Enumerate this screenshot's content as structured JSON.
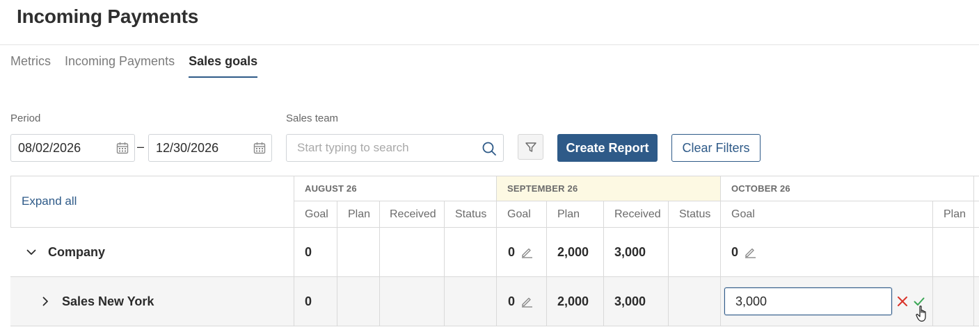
{
  "page": {
    "title": "Incoming Payments"
  },
  "tabs": [
    {
      "label": "Metrics",
      "active": false
    },
    {
      "label": "Incoming Payments",
      "active": false
    },
    {
      "label": "Sales goals",
      "active": true
    }
  ],
  "filters": {
    "period_label": "Period",
    "date_from": "08/02/2026",
    "date_separator": "–",
    "date_to": "12/30/2026",
    "sales_team_label": "Sales team",
    "sales_team_placeholder": "Start typing to search",
    "create_report_label": "Create Report",
    "clear_filters_label": "Clear Filters"
  },
  "table": {
    "expand_all_label": "Expand all",
    "months": [
      {
        "label": "AUGUST 26",
        "columns": [
          "Goal",
          "Plan",
          "Received",
          "Status"
        ]
      },
      {
        "label": "SEPTEMBER 26",
        "columns": [
          "Goal",
          "Plan",
          "Received",
          "Status"
        ],
        "highlighted": true
      },
      {
        "label": "OCTOBER 26",
        "columns": [
          "Goal",
          "Plan"
        ]
      }
    ],
    "rows": [
      {
        "name": "Company",
        "expanded": true,
        "aug": {
          "goal": "0",
          "plan": "",
          "received": "",
          "status": ""
        },
        "sep": {
          "goal": "0",
          "plan": "2,000",
          "received": "3,000",
          "status": ""
        },
        "oct": {
          "goal": "0",
          "plan": ""
        }
      },
      {
        "name": "Sales New York",
        "expanded": false,
        "aug": {
          "goal": "0",
          "plan": "",
          "received": "",
          "status": ""
        },
        "sep": {
          "goal": "0",
          "plan": "2,000",
          "received": "3,000",
          "status": ""
        },
        "oct": {
          "goal_editing_value": "3,000",
          "plan": ""
        }
      }
    ]
  },
  "colors": {
    "accent": "#2e5a88",
    "highlight_month": "#fdf9e3",
    "cancel": "#d9342b",
    "confirm": "#3aa655"
  },
  "icons": {
    "calendar": "calendar-icon",
    "search": "search-icon",
    "filter": "filter-icon",
    "edit": "pencil-icon",
    "expand": "chevron-icon",
    "cancel": "close-icon",
    "confirm": "check-icon"
  }
}
